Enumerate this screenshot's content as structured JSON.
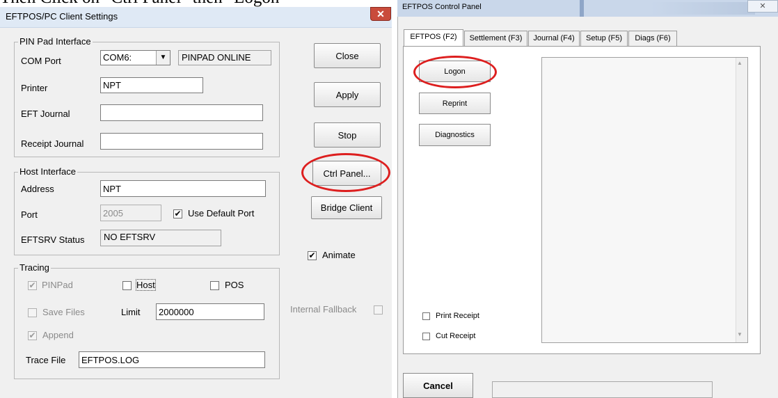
{
  "caption": "Then Click on \"Ctrl Panel\" then \"Logon\"",
  "win1": {
    "title": "EFTPOS/PC Client Settings",
    "close_glyph": "✕",
    "pin_pad": {
      "legend": "PIN Pad Interface",
      "com_port_label": "COM Port",
      "com_port_value": "COM6:",
      "dropdown_glyph": "▼",
      "status": "PINPAD ONLINE",
      "printer_label": "Printer",
      "printer_value": "NPT",
      "eft_journal_label": "EFT Journal",
      "eft_journal_value": "",
      "receipt_journal_label": "Receipt Journal",
      "receipt_journal_value": ""
    },
    "host": {
      "legend": "Host Interface",
      "address_label": "Address",
      "address_value": "NPT",
      "port_label": "Port",
      "port_value": "2005",
      "use_default_port_label": "Use Default Port",
      "use_default_port_checked": "✔",
      "eftsrv_status_label": "EFTSRV Status",
      "eftsrv_status_value": "NO EFTSRV"
    },
    "tracing": {
      "legend": "Tracing",
      "pinpad_label": "PINPad",
      "pinpad_checked": "✔",
      "host_label": "Host",
      "pos_label": "POS",
      "save_files_label": "Save Files",
      "limit_label": "Limit",
      "limit_value": "2000000",
      "append_label": "Append",
      "append_checked": "✔",
      "trace_file_label": "Trace File",
      "trace_file_value": "EFTPOS.LOG"
    },
    "buttons": {
      "close": "Close",
      "apply": "Apply",
      "stop": "Stop",
      "ctrl_panel": "Ctrl Panel...",
      "bridge_client": "Bridge Client"
    },
    "animate_label": "Animate",
    "animate_checked": "✔",
    "internal_fallback_label": "Internal Fallback"
  },
  "win2": {
    "title": "EFTPOS Control Panel",
    "close_glyph": "✕",
    "tabs": [
      "EFTPOS (F2)",
      "Settlement (F3)",
      "Journal (F4)",
      "Setup (F5)",
      "Diags (F6)"
    ],
    "buttons": {
      "logon": "Logon",
      "reprint": "Reprint",
      "diagnostics": "Diagnostics",
      "cancel": "Cancel"
    },
    "print_receipt_label": "Print Receipt",
    "cut_receipt_label": "Cut Receipt",
    "scroll_up_glyph": "▲",
    "scroll_down_glyph": "▼"
  },
  "colors": {
    "highlight_oval": "#dd1f1f",
    "window_bg": "#f0f0f0",
    "close_button": "#c94c3c"
  }
}
